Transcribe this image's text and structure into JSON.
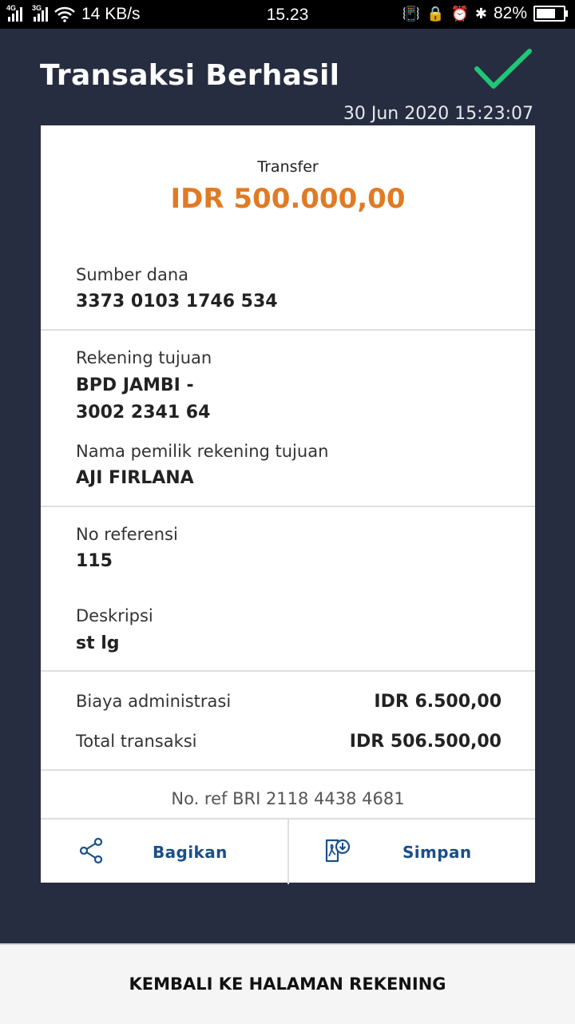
{
  "status_bar": {
    "net1": "4G",
    "net2": "3G",
    "speed": "14 KB/s",
    "time": "15.23",
    "battery": "82%",
    "battery_level": 0.82
  },
  "header": {
    "title": "Transaksi Berhasil",
    "datetime": "30 Jun 2020 15:23:07"
  },
  "colors": {
    "background": "#262d40",
    "success_check": "#1fc777",
    "amount": "#e07b25",
    "action": "#1b4f8a"
  },
  "receipt": {
    "type": "Transfer",
    "amount": "IDR 500.000,00",
    "source_label": "Sumber dana",
    "source_value": "3373 0103 1746 534",
    "dest_label": "Rekening tujuan",
    "dest_bank": "BPD JAMBI -",
    "dest_account": "3002 2341 64",
    "owner_label": "Nama pemilik rekening tujuan",
    "owner_value": "AJI FIRLANA",
    "ref_label": "No referensi",
    "ref_value": "115",
    "desc_label": "Deskripsi",
    "desc_value": "st lg",
    "fee_label": "Biaya administrasi",
    "fee_value": "IDR 6.500,00",
    "total_label": "Total transaksi",
    "total_value": "IDR 506.500,00",
    "bri_ref": "No. ref BRI 2118 4438 4681"
  },
  "actions": {
    "share_label": "Bagikan",
    "save_label": "Simpan"
  },
  "footer": {
    "back_label": "KEMBALI KE HALAMAN REKENING"
  }
}
